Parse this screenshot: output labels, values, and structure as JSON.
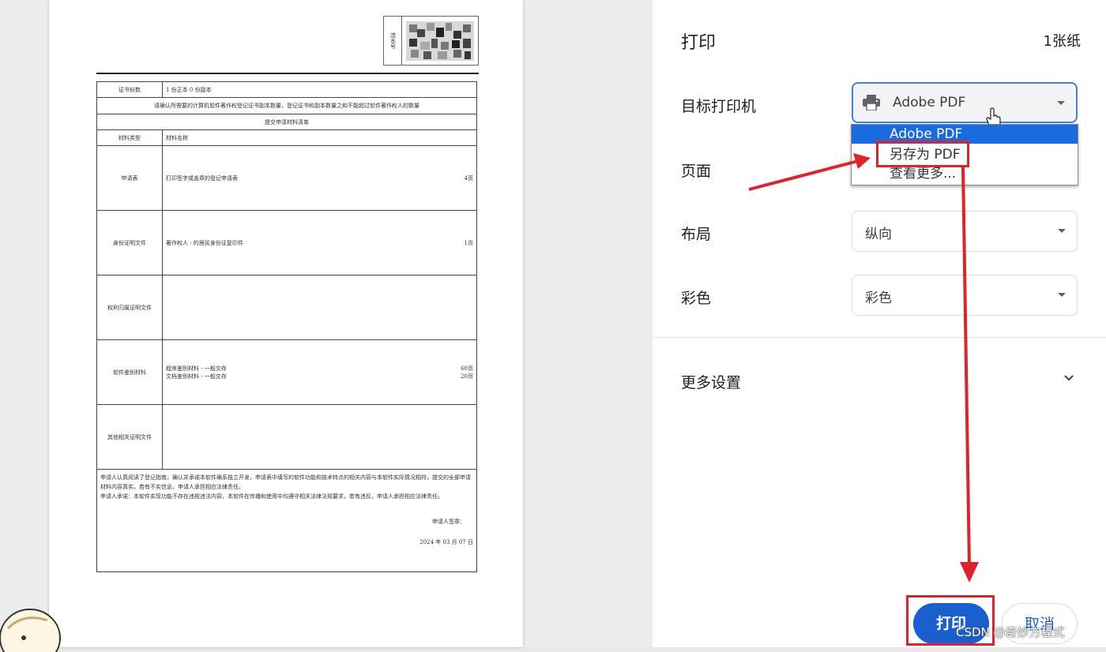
{
  "preview": {
    "serial_label": "流水号",
    "rows": {
      "copies_label": "证书份数",
      "copies_value": "1 份正本  0 份副本",
      "notice": "请确认所需要的计算机软件著作权登记证书副本数量，登记证书和副本数量之和不能超过软件著作权人的数量",
      "list_title": "提交申请材料清单",
      "col_type": "材料类型",
      "col_name": "材料名称",
      "r1_type": "申请表",
      "r1_name": "打印签字或盖章的登记申请表",
      "r1_pages": "4页",
      "r2_type": "身份证明文件",
      "r2_name": "著作权人 -     的居民身份证复印件",
      "r2_pages": "1页",
      "r3_type": "权利归属证明文件",
      "r4_type": "软件鉴别材料",
      "r4_name1": "程序鉴别材料 - 一般交存",
      "r4_pages1": "60页",
      "r4_name2": "文档鉴别材料 - 一般交存",
      "r4_pages2": "20页",
      "r5_type": "其他相关证明文件",
      "decl1": "申请人认真阅读了登记指南，确认并承诺本软件确系独立开发，申请表中填写的软件功能和技术特点的相关内容与本软件实际情况相符，提交的全部申请材料内容真实，若有不实信息，申请人承担相应法律责任。",
      "decl2": "申请人承诺：本软件实现功能不存在违规违法内容，本软件在传播和使用中均遵守相关法律法规要求，若有违反，申请人承担相应法律责任。",
      "sign": "申请人签章：",
      "date": "2024 年 03 月 07 日"
    }
  },
  "panel": {
    "title": "打印",
    "sheets": "1张纸",
    "destination_label": "目标打印机",
    "destination_value": "Adobe PDF",
    "dropdown_options": [
      "Adobe PDF",
      "另存为 PDF",
      "查看更多..."
    ],
    "pages_label": "页面",
    "layout_label": "布局",
    "layout_value": "纵向",
    "color_label": "彩色",
    "color_value": "彩色",
    "more_settings": "更多设置",
    "print_button": "打印",
    "cancel_button": "取消"
  },
  "watermark": "CSDN @奇妙方程式",
  "colors": {
    "accent": "#1a5fd0",
    "highlight": "#e0232b",
    "selected_option": "#1a6be0"
  }
}
